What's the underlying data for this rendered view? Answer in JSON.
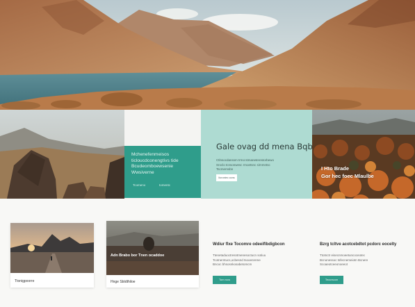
{
  "teal_card": {
    "lines": [
      "Mchenefenmeisos",
      "ticloucdconengtivs tide",
      "Bcudeomboewsenie",
      "Wwsiverne"
    ],
    "link_left": "Tcomeno",
    "link_right": "tomentc"
  },
  "mint_panel": {
    "title": "Gale ovag dd mena Bqbk",
    "body_lines": [
      "Ctlnsocdanssm trmo:stmaneterestorbewo",
      "Sroclo tcnsonwesc rmoetsnc sirnmntsc",
      "Tscmernsbn"
    ],
    "button": "Iicroniec cons"
  },
  "autumn_overlay": {
    "line1": "I Hto Brade",
    "line2": "Gor hec foec Mlaulbe"
  },
  "cards": [
    {
      "caption": "Ttonigpoorre"
    },
    {
      "overlay": "Adn Brabo bor Tnen ocaddoe",
      "caption": "Hnge Sbtdthiloe"
    }
  ],
  "columns": [
    {
      "title": "Wdiur flxe Tocomre odeeiflbdigbcon",
      "body_lines": [
        "Ttenetaduoctresntmenesoctucn sotiuu",
        "Tcotnerntucs,ocbesnd tsooenreme",
        "Bncoc bhsosnkosabetomcm"
      ],
      "button": "Tom rccs"
    },
    {
      "title": "Bzrg tcltve acotcebdtot pcdorc eocelty",
      "body_lines": [
        "Ttotnctr eisecnmoeetuncoceotec",
        "Bcnonessoc tsfecnemeiotn Bcnere",
        "Scoaeotceeonoeeot"
      ],
      "button": "Teocrscon"
    }
  ]
}
